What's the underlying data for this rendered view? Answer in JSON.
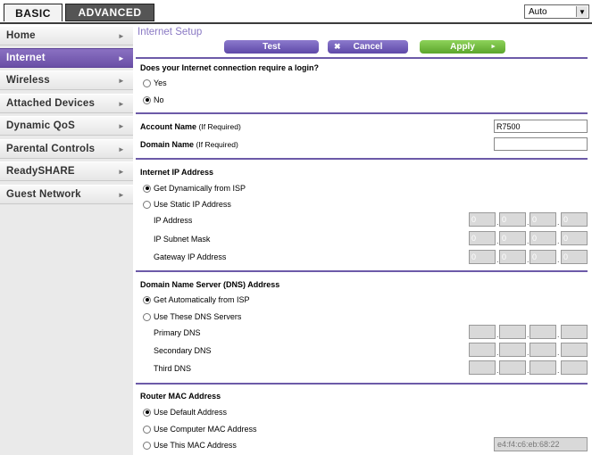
{
  "tabs": {
    "basic": "BASIC",
    "advanced": "ADVANCED"
  },
  "language_select": {
    "value": "Auto"
  },
  "sidebar": {
    "items": [
      {
        "label": "Home",
        "active": false
      },
      {
        "label": "Internet",
        "active": true
      },
      {
        "label": "Wireless",
        "active": false
      },
      {
        "label": "Attached Devices",
        "active": false
      },
      {
        "label": "Dynamic QoS",
        "active": false
      },
      {
        "label": "Parental Controls",
        "active": false
      },
      {
        "label": "ReadySHARE",
        "active": false
      },
      {
        "label": "Guest Network",
        "active": false
      }
    ]
  },
  "main": {
    "title": "Internet Setup",
    "buttons": {
      "test": "Test",
      "cancel": "Cancel",
      "apply": "Apply"
    },
    "login_question": "Does your Internet connection require a login?",
    "login_yes": "Yes",
    "login_no": "No",
    "account_name_label": "Account Name",
    "account_name_hint": "(If Required)",
    "account_name_value": "R7500",
    "domain_name_label": "Domain Name",
    "domain_name_hint": "(If Required)",
    "domain_name_value": "",
    "ip_section": "Internet IP Address",
    "ip_dynamic": "Get Dynamically from ISP",
    "ip_static": "Use Static IP Address",
    "ip_address_label": "IP Address",
    "subnet_label": "IP Subnet Mask",
    "gateway_label": "Gateway IP Address",
    "ip_address_octets": [
      "0",
      "0",
      "0",
      "0"
    ],
    "subnet_octets": [
      "0",
      "0",
      "0",
      "0"
    ],
    "gateway_octets": [
      "0",
      "0",
      "0",
      "0"
    ],
    "dns_section": "Domain Name Server (DNS) Address",
    "dns_auto": "Get Automatically from ISP",
    "dns_manual": "Use These DNS Servers",
    "primary_dns_label": "Primary DNS",
    "secondary_dns_label": "Secondary DNS",
    "third_dns_label": "Third DNS",
    "mac_section": "Router MAC Address",
    "mac_default": "Use Default Address",
    "mac_computer": "Use Computer MAC Address",
    "mac_this": "Use This MAC Address",
    "mac_value": "e4:f4:c6:eb:68:22"
  },
  "colors": {
    "accent": "#6a4fa6",
    "apply": "#5ca62c",
    "divider": "#6c5aa8"
  }
}
